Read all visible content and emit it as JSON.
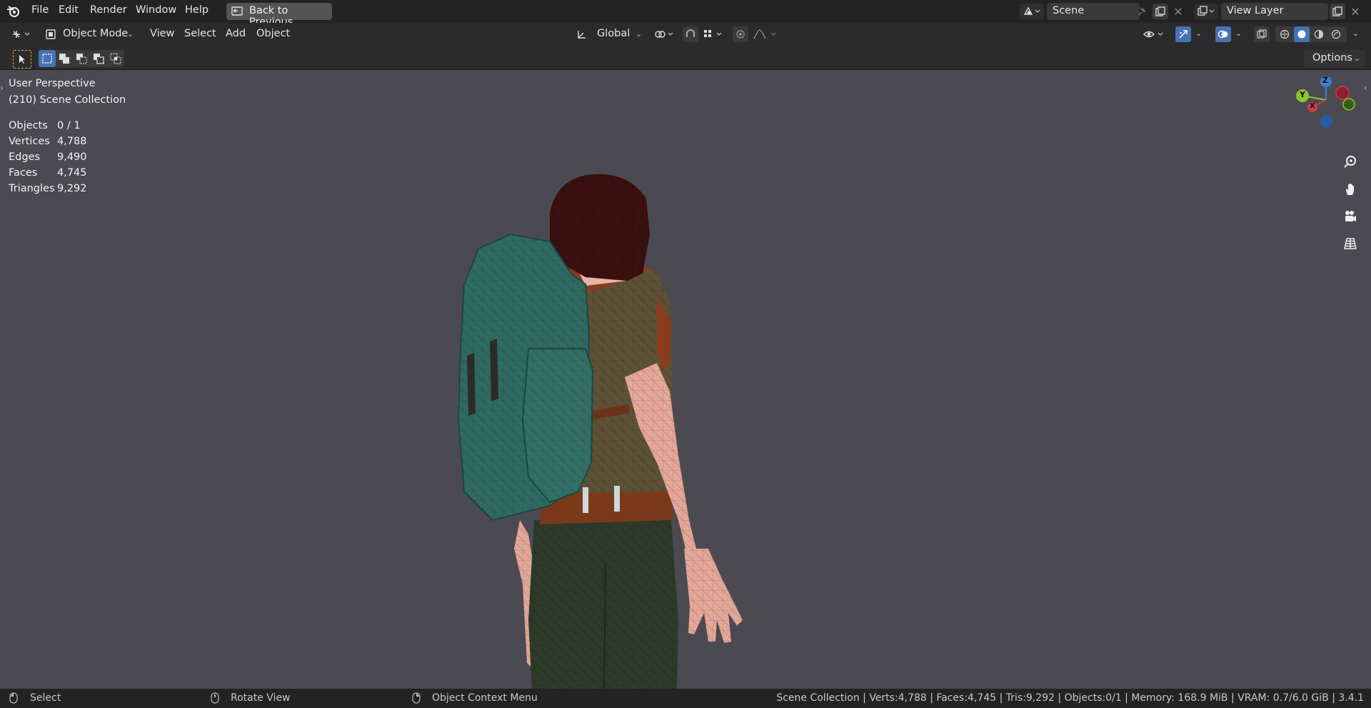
{
  "menus": {
    "file": "File",
    "edit": "Edit",
    "render": "Render",
    "window": "Window",
    "help": "Help",
    "back_to_previous": "Back to Previous"
  },
  "scene": {
    "name": "Scene",
    "view_layer": "View Layer"
  },
  "header": {
    "mode": "Object Mode",
    "view": "View",
    "select": "Select",
    "add": "Add",
    "object": "Object",
    "orientation": "Global",
    "options": "Options"
  },
  "overlay": {
    "perspective": "User Perspective",
    "collection": "(210) Scene Collection",
    "stats": [
      {
        "label": "Objects",
        "value": "0 / 1"
      },
      {
        "label": "Vertices",
        "value": "4,788"
      },
      {
        "label": "Edges",
        "value": "9,490"
      },
      {
        "label": "Faces",
        "value": "4,745"
      },
      {
        "label": "Triangles",
        "value": "9,292"
      }
    ]
  },
  "gizmo": {
    "z": "Z",
    "y": "Y",
    "x": "X"
  },
  "icons": {
    "logo": "blender-logo-icon",
    "back": "back-to-previous-icon",
    "zoom": "zoom-icon",
    "pan": "hand-pan-icon",
    "camera": "camera-view-icon",
    "grid": "ortho-grid-icon"
  },
  "colors": {
    "viewport": "#4b4a52",
    "accent": "#4772b3",
    "axis_x": "#c83a4a",
    "axis_y": "#8ac430",
    "axis_z": "#3f7ed1"
  },
  "status": {
    "select": "Select",
    "rotate": "Rotate View",
    "context": "Object Context Menu",
    "info": "Scene Collection | Verts:4,788 | Faces:4,745 | Tris:9,292 | Objects:0/1 | Memory: 168.9 MiB | VRAM: 0.7/6.0 GiB | 3.4.1"
  }
}
